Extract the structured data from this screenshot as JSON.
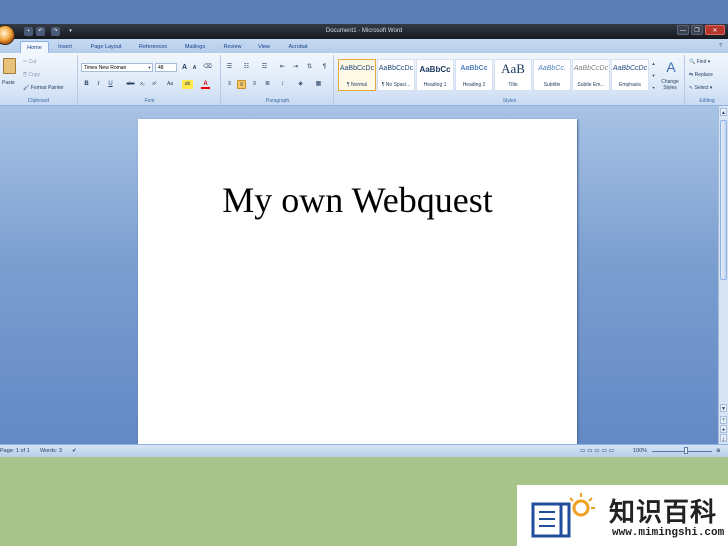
{
  "window": {
    "title": "Document1 - Microsoft Word",
    "buttons": {
      "minimize": "—",
      "restore": "❐",
      "close": "✕"
    }
  },
  "tabs": [
    "Home",
    "Insert",
    "Page Layout",
    "References",
    "Mailings",
    "Review",
    "View",
    "Acrobat"
  ],
  "active_tab": "Home",
  "ribbon": {
    "clipboard": {
      "paste": "Paste",
      "cut": "Cut",
      "copy": "Copy",
      "format_painter": "Format Painter",
      "label": "Clipboard"
    },
    "font": {
      "name": "Times New Roman",
      "size": "48",
      "label": "Font",
      "grow": "A",
      "shrink": "A",
      "clear": "⌫",
      "bold": "B",
      "italic": "I",
      "underline": "U",
      "strike": "abc",
      "subscript": "x₂",
      "superscript": "x²",
      "case": "Aa",
      "highlight": "ab",
      "color": "A"
    },
    "paragraph": {
      "label": "Paragraph",
      "pilcrow": "¶"
    },
    "styles": {
      "label": "Styles",
      "items": [
        {
          "preview": "AaBbCcDc",
          "name": "¶ Normal"
        },
        {
          "preview": "AaBbCcDc",
          "name": "¶ No Spaci..."
        },
        {
          "preview": "AaBbCc",
          "name": "Heading 1"
        },
        {
          "preview": "AaBbCc",
          "name": "Heading 2"
        },
        {
          "preview": "AaB",
          "name": "Title"
        },
        {
          "preview": "AaBbCc.",
          "name": "Subtitle"
        },
        {
          "preview": "AaBbCcDc",
          "name": "Subtle Em..."
        },
        {
          "preview": "AaBbCcDc",
          "name": "Emphasis"
        }
      ],
      "change_styles": "Change Styles"
    },
    "editing": {
      "find": "Find",
      "replace": "Replace",
      "select": "Select",
      "label": "Editing"
    }
  },
  "document": {
    "text": "My own Webquest"
  },
  "status": {
    "page": "Page: 1 of 1",
    "words": "Words: 3",
    "zoom": "100%"
  },
  "watermark": {
    "text": "知识百科",
    "url": "www.mimingshi.com"
  },
  "colors": {
    "ribbon": "#dde9f8",
    "tab_text": "#15428b",
    "doc_bg": "#7c9fd0",
    "background": "#a9c48b"
  }
}
